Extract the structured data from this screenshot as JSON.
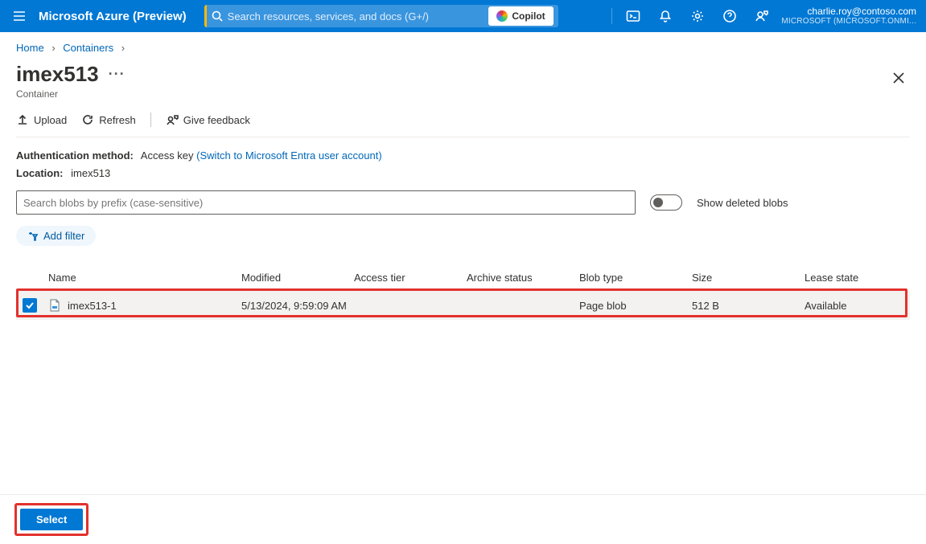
{
  "header": {
    "brand": "Microsoft Azure (Preview)",
    "search_placeholder": "Search resources, services, and docs (G+/)",
    "copilot_label": "Copilot",
    "user_email": "charlie.roy@contoso.com",
    "user_directory": "MICROSOFT (MICROSOFT.ONMI..."
  },
  "breadcrumb": {
    "items": [
      "Home",
      "Containers"
    ]
  },
  "page": {
    "title": "imex513",
    "resource_type": "Container"
  },
  "actions": {
    "upload": "Upload",
    "refresh": "Refresh",
    "feedback": "Give feedback"
  },
  "info": {
    "auth_label": "Authentication method:",
    "auth_value": "Access key",
    "auth_switch_link": "(Switch to Microsoft Entra user account)",
    "location_label": "Location:",
    "location_value": "imex513"
  },
  "filters": {
    "search_placeholder": "Search blobs by prefix (case-sensitive)",
    "show_deleted_label": "Show deleted blobs",
    "add_filter_label": "Add filter"
  },
  "table": {
    "columns": {
      "name": "Name",
      "modified": "Modified",
      "access_tier": "Access tier",
      "archive_status": "Archive status",
      "blob_type": "Blob type",
      "size": "Size",
      "lease_state": "Lease state"
    },
    "rows": [
      {
        "selected": true,
        "name": "imex513-1",
        "modified": "5/13/2024, 9:59:09 AM",
        "access_tier": "",
        "archive_status": "",
        "blob_type": "Page blob",
        "size": "512 B",
        "lease_state": "Available"
      }
    ]
  },
  "footer": {
    "select_label": "Select"
  }
}
